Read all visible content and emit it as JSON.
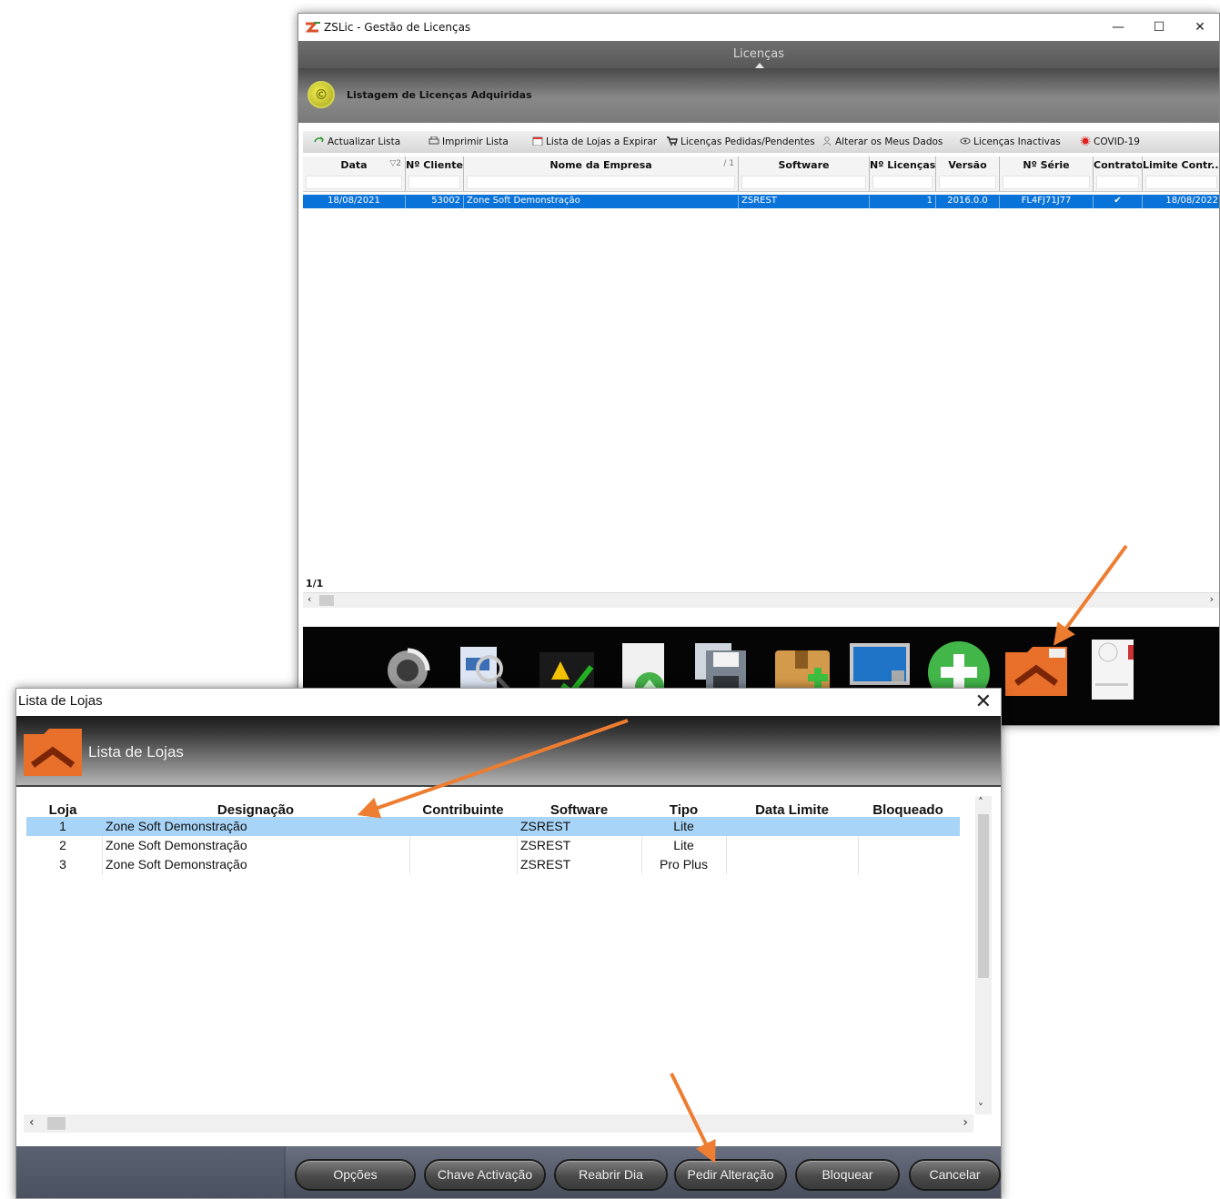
{
  "main_window": {
    "title": "ZSLic - Gestão de Licenças",
    "controls": {
      "minimize": "—",
      "maximize": "☐",
      "close": "✕"
    },
    "header_tab": "Licenças",
    "banner_title": "Listagem de Licenças Adquiridas",
    "toolbar": [
      {
        "label": "Actualizar Lista",
        "icon": "refresh-icon"
      },
      {
        "label": "Imprimir Lista",
        "icon": "printer-icon"
      },
      {
        "label": "Lista de Lojas a Expirar",
        "icon": "calendar-icon"
      },
      {
        "label": "Licenças Pedidas/Pendentes",
        "icon": "cart-icon"
      },
      {
        "label": "Alterar os Meus Dados",
        "icon": "user-icon"
      },
      {
        "label": "Licenças Inactivas",
        "icon": "eye-icon"
      },
      {
        "label": "COVID-19",
        "icon": "virus-icon"
      }
    ],
    "grid": {
      "columns": [
        {
          "label": "Data",
          "sort": "▽2"
        },
        {
          "label": "Nº Cliente",
          "sort": ""
        },
        {
          "label": "Nome da Empresa",
          "sort": "/ 1"
        },
        {
          "label": "Software",
          "sort": ""
        },
        {
          "label": "Nº Licenças",
          "sort": ""
        },
        {
          "label": "Versão",
          "sort": ""
        },
        {
          "label": "Nº Série",
          "sort": ""
        },
        {
          "label": "Contrato",
          "sort": ""
        },
        {
          "label": "Limite Contr...",
          "sort": ""
        }
      ],
      "rows": [
        {
          "data": "18/08/2021",
          "cliente": "53002",
          "empresa": "Zone Soft Demonstração",
          "software": "ZSREST",
          "licencas": "1",
          "versao": "2016.0.0",
          "serie": "FL4FJ71J77",
          "contrato": "✔",
          "limite": "18/08/2022"
        }
      ],
      "pager": "1/1"
    },
    "dock_icons": [
      "refresh-icon",
      "search-document-icon",
      "warning-check-icon",
      "upload-document-icon",
      "save-icon",
      "package-add-icon",
      "monitor-lock-icon",
      "add-icon",
      "stores-folder-icon",
      "certificate-icon"
    ]
  },
  "dialog": {
    "title": "Lista de Lojas",
    "close": "✕",
    "banner_title": "Lista de Lojas",
    "columns": [
      "Loja",
      "Designação",
      "Contribuinte",
      "Software",
      "Tipo",
      "Data Limite",
      "Bloqueado"
    ],
    "rows": [
      {
        "loja": "1",
        "designacao": "Zone Soft Demonstração",
        "contribuinte": "",
        "software": "ZSREST",
        "tipo": "Lite",
        "data_limite": "",
        "bloqueado": ""
      },
      {
        "loja": "2",
        "designacao": "Zone Soft Demonstração",
        "contribuinte": "",
        "software": "ZSREST",
        "tipo": "Lite",
        "data_limite": "",
        "bloqueado": ""
      },
      {
        "loja": "3",
        "designacao": "Zone Soft Demonstração",
        "contribuinte": "",
        "software": "ZSREST",
        "tipo": "Pro Plus",
        "data_limite": "",
        "bloqueado": ""
      }
    ],
    "buttons": [
      "Opções",
      "Chave Activação",
      "Reabrir Dia",
      "Pedir Alteração",
      "Bloquear",
      "Cancelar"
    ]
  },
  "colors": {
    "selection_main": "#0a73d9",
    "selection_dialog": "#a8d4f7",
    "annotation_arrow": "#ed7d31",
    "folder_orange": "#e8702a"
  }
}
